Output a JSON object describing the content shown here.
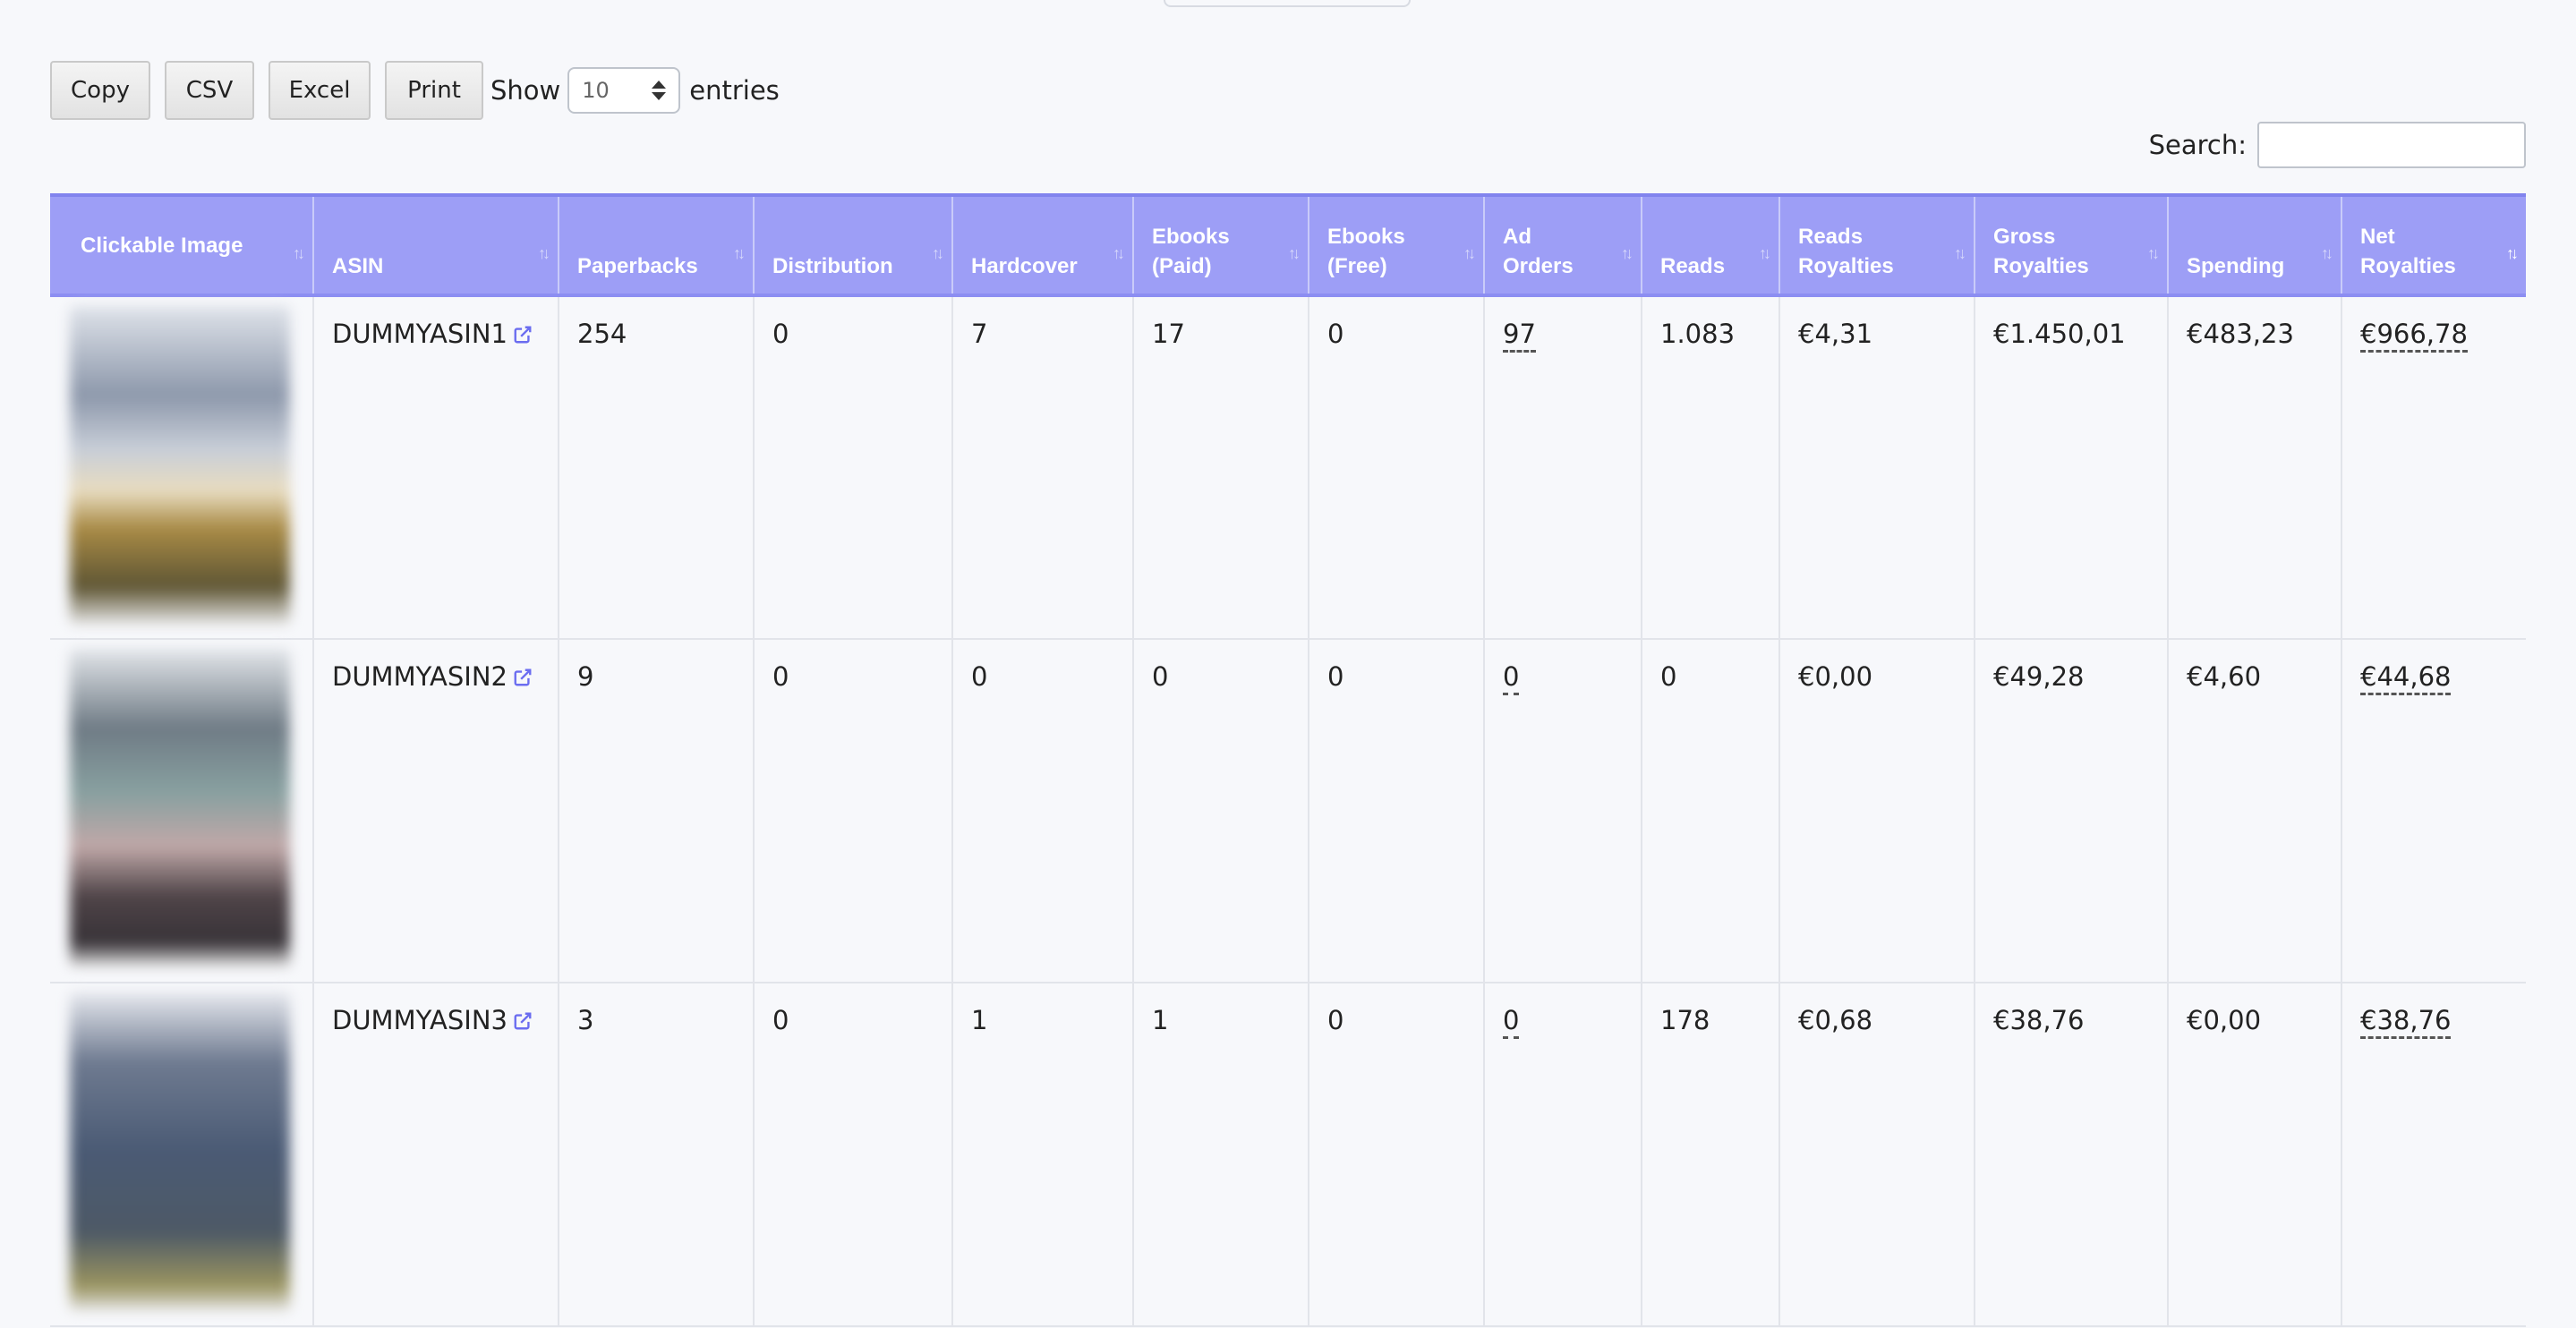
{
  "toolbar": {
    "buttons": [
      "Copy",
      "CSV",
      "Excel",
      "Print"
    ],
    "show_label": "Show",
    "entries_value": "10",
    "entries_label": "entries"
  },
  "search": {
    "label": "Search:",
    "placeholder": ""
  },
  "table": {
    "headers": [
      [
        "Clickable Image"
      ],
      [
        "ASIN"
      ],
      [
        "Paperbacks"
      ],
      [
        "Distribution"
      ],
      [
        "Hardcover"
      ],
      [
        "Ebooks",
        "(Paid)"
      ],
      [
        "Ebooks",
        "(Free)"
      ],
      [
        "Ad",
        "Orders"
      ],
      [
        "Reads"
      ],
      [
        "Reads",
        "Royalties"
      ],
      [
        "Gross",
        "Royalties"
      ],
      [
        "Spending"
      ],
      [
        "Net",
        "Royalties"
      ]
    ],
    "sorted_column": "Net Royalties",
    "rows": [
      {
        "asin": "DUMMYASIN1",
        "paperbacks": "254",
        "distribution": "0",
        "hardcover": "7",
        "ebooks_paid": "17",
        "ebooks_free": "0",
        "ad_orders": "97",
        "reads": "1.083",
        "reads_royalties": "€4,31",
        "gross_royalties": "€1.450,01",
        "spending": "€483,23",
        "net_royalties": "€966,78"
      },
      {
        "asin": "DUMMYASIN2",
        "paperbacks": "9",
        "distribution": "0",
        "hardcover": "0",
        "ebooks_paid": "0",
        "ebooks_free": "0",
        "ad_orders": "0",
        "reads": "0",
        "reads_royalties": "€0,00",
        "gross_royalties": "€49,28",
        "spending": "€4,60",
        "net_royalties": "€44,68"
      },
      {
        "asin": "DUMMYASIN3",
        "paperbacks": "3",
        "distribution": "0",
        "hardcover": "1",
        "ebooks_paid": "1",
        "ebooks_free": "0",
        "ad_orders": "0",
        "reads": "178",
        "reads_royalties": "€0,68",
        "gross_royalties": "€38,76",
        "spending": "€0,00",
        "net_royalties": "€38,76"
      }
    ]
  },
  "colors": {
    "header_bg": "#9d9ef6",
    "accent": "#6b6df0"
  },
  "icons": {
    "external_link": "external-link-icon",
    "sort": "sort-icon"
  }
}
